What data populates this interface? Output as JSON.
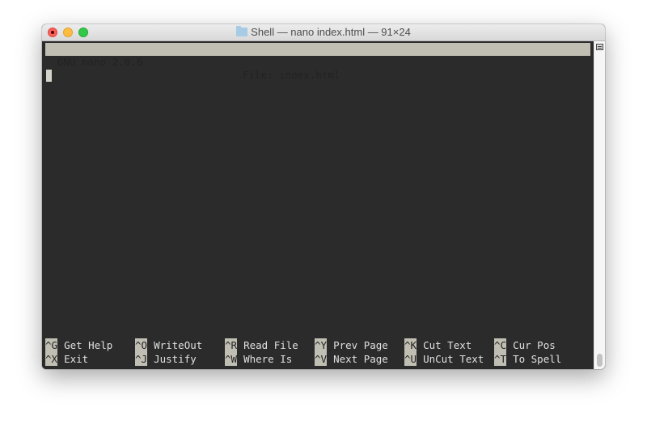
{
  "window": {
    "title": "Shell — nano index.html — 91×24",
    "title_icon": "folder-icon"
  },
  "nano": {
    "version": "GNU nano 2.0.6",
    "file_label": "File: index.html"
  },
  "shortcuts": [
    {
      "key": "^G",
      "label": "Get Help"
    },
    {
      "key": "^O",
      "label": "WriteOut"
    },
    {
      "key": "^R",
      "label": "Read File"
    },
    {
      "key": "^Y",
      "label": "Prev Page"
    },
    {
      "key": "^K",
      "label": "Cut Text"
    },
    {
      "key": "^C",
      "label": "Cur Pos"
    },
    {
      "key": "^X",
      "label": "Exit"
    },
    {
      "key": "^J",
      "label": "Justify"
    },
    {
      "key": "^W",
      "label": "Where Is"
    },
    {
      "key": "^V",
      "label": "Next Page"
    },
    {
      "key": "^U",
      "label": "UnCut Text"
    },
    {
      "key": "^T",
      "label": "To Spell"
    }
  ],
  "colors": {
    "terminal_bg": "#2b2b2b",
    "header_bg": "#c1bfb3",
    "close": "#fc605c",
    "minimize": "#fdbc40",
    "maximize": "#34c84a"
  }
}
